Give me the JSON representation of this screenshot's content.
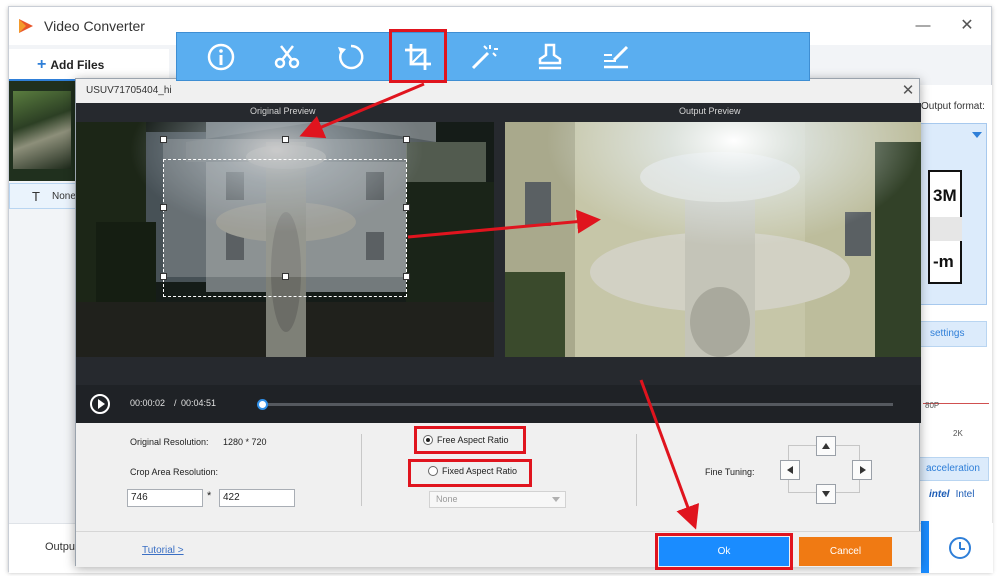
{
  "app": {
    "title": "Video Converter",
    "add_files_label": "Add Files",
    "subtitle_value": "None",
    "output_format_label": "Output format:",
    "format_card_top": "3M",
    "format_card_bottom": "-m",
    "settings_label": "settings",
    "resolution_low": "80P",
    "resolution_high": "2K",
    "hw_accel_label": "acceleration",
    "intel_label": "Intel",
    "output_label": "Output"
  },
  "toolbar": {
    "tools": [
      {
        "icon": "info-icon"
      },
      {
        "icon": "scissors-icon"
      },
      {
        "icon": "rotate-icon"
      },
      {
        "icon": "crop-icon",
        "active": true
      },
      {
        "icon": "magic-wand-icon"
      },
      {
        "icon": "stamp-icon"
      },
      {
        "icon": "edit-subtitle-icon"
      }
    ]
  },
  "dialog": {
    "title": "USUV71705404_hi",
    "original_preview_label": "Original Preview",
    "output_preview_label": "Output Preview",
    "time_current": "00:00:02",
    "time_separator": "/",
    "time_total": "00:04:51",
    "progress": 0.007,
    "original_resolution_label": "Original Resolution:",
    "original_resolution_value": "1280 * 720",
    "crop_area_label": "Crop Area Resolution:",
    "crop_width": "746",
    "crop_height": "422",
    "times_sign": "*",
    "free_aspect_label": "Free Aspect Ratio",
    "fixed_aspect_label": "Fixed Aspect Ratio",
    "free_selected": true,
    "aspect_select_value": "None",
    "fine_tuning_label": "Fine Tuning:",
    "tutorial_label": "Tutorial >",
    "ok_label": "Ok",
    "cancel_label": "Cancel"
  },
  "colors": {
    "accent": "#1a8cff",
    "cancel": "#f07a13",
    "highlight": "#e0141e",
    "toolbar": "#5aaef0"
  }
}
